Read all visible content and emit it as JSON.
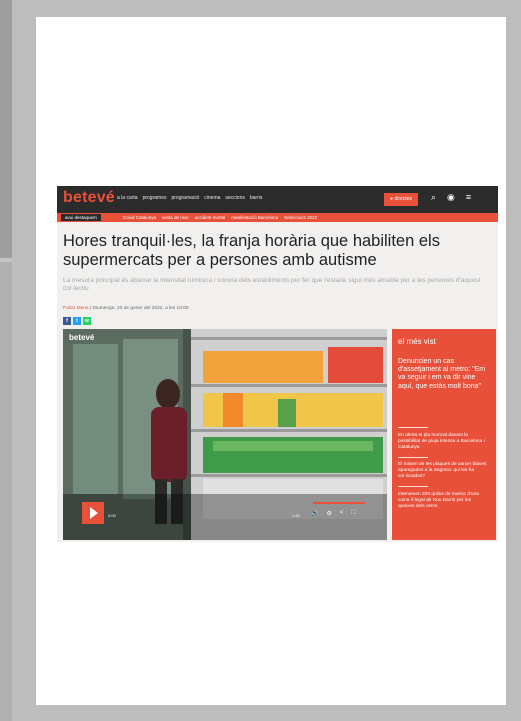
{
  "site": {
    "logo": "betevé",
    "nav": [
      "a la carta",
      "programes",
      "programació",
      "cinema",
      "seccions",
      "barris"
    ],
    "live_button": "● directes",
    "icons": [
      "search-icon",
      "user-icon",
      "menu-icon"
    ]
  },
  "subnav": {
    "tag": "avui destaquem",
    "links": [
      "Covid Catalunya",
      "vesta de moc",
      "accident mortal",
      "manifestació Barcelona",
      "Seleccions 2022"
    ]
  },
  "article": {
    "headline": "Hores tranquil·les, la franja horària que habiliten els supermercats per a persones amb autisme",
    "subhead": "La mesura principal és abaixar la intensitat lumínica i sonora dels establiments per fer que l'estada sigui més amable per a les persones d'aquest col·lectiu",
    "author": "Pablo Mena",
    "date": "| Diumenge, 23 de gener del 2022, a les 10:00",
    "share": [
      "f",
      "t",
      "w"
    ]
  },
  "video": {
    "watermark": "betevé",
    "time_current": "0:00",
    "time_total": "1:43"
  },
  "sidebar": {
    "title": "el més vist",
    "items": [
      "Denuncien un cas d'assetjament al metro: \"Em va seguir i em va dir vine aquí, que estàs molt bona\"",
      "En alerta el pla Inuncat davant la possibilitat de pluja intensa a Barcelona i Catalunya",
      "El misteri de les plaques de xarxer blaves aparegudes a la Sagrera: qui les ha col·locades?",
      "Intervenen 200 quilos de marisc d'una cuina il·legal de Nou Barris per les queixes dels veïns"
    ]
  },
  "colors": {
    "brand": "#e8503a",
    "topbar": "#2b2b2b",
    "page_bg": "#bdbdbd"
  }
}
